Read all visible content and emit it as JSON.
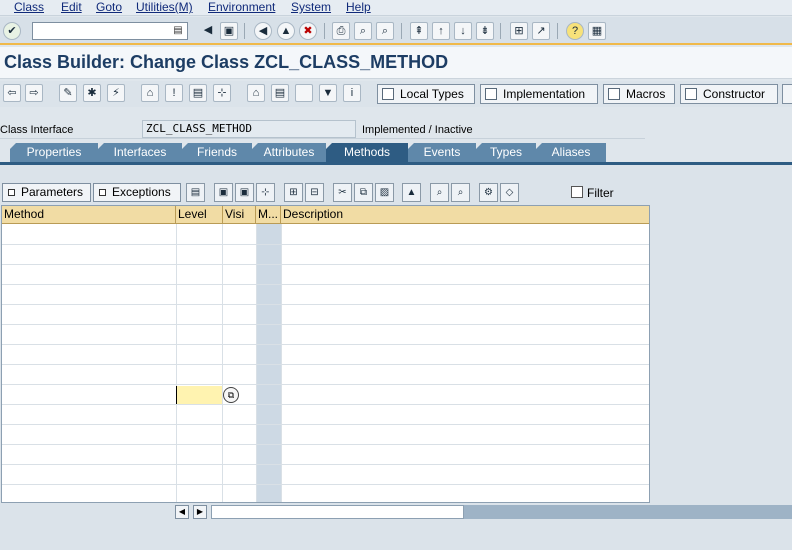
{
  "menu": [
    "Class",
    "Edit",
    "Goto",
    "Utilities(M)",
    "Environment",
    "System",
    "Help"
  ],
  "title": "Class Builder: Change Class ZCL_CLASS_METHOD",
  "app_buttons": {
    "local_types": "Local Types",
    "implementation": "Implementation",
    "macros": "Macros",
    "constructor": "Constructor"
  },
  "class_interface": {
    "label": "Class Interface",
    "value": "ZCL_CLASS_METHOD",
    "status": "Implemented / Inactive"
  },
  "tabs": [
    "Properties",
    "Interfaces",
    "Friends",
    "Attributes",
    "Methods",
    "Events",
    "Types",
    "Aliases"
  ],
  "active_tab": "Methods",
  "sub_buttons": {
    "parameters": "Parameters",
    "exceptions": "Exceptions"
  },
  "filter_label": "Filter",
  "grid": {
    "columns": [
      "Method",
      "Level",
      "Visi",
      "M...",
      "Description"
    ]
  },
  "colors": {
    "accent": "#f0b94a",
    "tab": "#5f88aa",
    "tab_active": "#2e5c83",
    "grid_header": "#f1dca4",
    "title": "#1d3d64"
  },
  "icons": {
    "enter": "checkmark-icon",
    "save": "save-icon",
    "back": "back-icon",
    "exit": "exit-icon",
    "cancel": "cancel-icon",
    "print": "print-icon",
    "find": "find-icon",
    "help": "help-icon"
  }
}
